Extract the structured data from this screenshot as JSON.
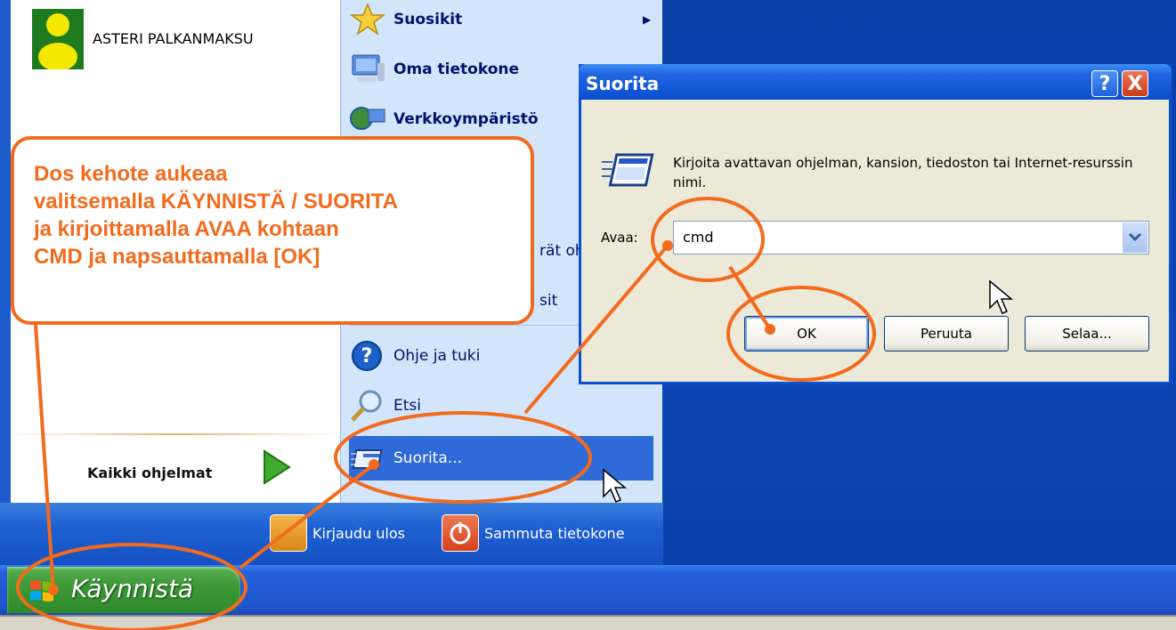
{
  "start_menu": {
    "pinned": [
      {
        "label": "ASTERI PALKANMAKSU"
      }
    ],
    "all_programs": "Kaikki ohjelmat",
    "right_items": [
      {
        "label": "Suosikit",
        "bold": true
      },
      {
        "label": "Oma tietokone",
        "bold": true
      },
      {
        "label": "Verkkoympäristö",
        "bold": true
      },
      {
        "label": "rät oh",
        "bold": false
      },
      {
        "label": "sit",
        "bold": false
      },
      {
        "label": "Ohje ja tuki",
        "bold": false
      },
      {
        "label": "Etsi",
        "bold": false
      },
      {
        "label": "Suorita...",
        "bold": false
      }
    ],
    "logoff": "Kirjaudu ulos",
    "shutdown": "Sammuta tietokone"
  },
  "taskbar": {
    "start_label": "Käynnistä"
  },
  "dialog": {
    "title": "Suorita",
    "help": "?",
    "close": "X",
    "prompt": "Kirjoita avattavan ohjelman, kansion, tiedoston tai Internet-resurssin nimi.",
    "open_label": "Avaa:",
    "input_value": "cmd",
    "ok": "OK",
    "cancel": "Peruuta",
    "browse": "Selaa..."
  },
  "callout": {
    "lines": [
      "Dos kehote aukeaa",
      "valitsemalla KÄYNNISTÄ / SUORITA",
      "ja kirjoittamalla AVAA kohtaan",
      "CMD ja napsauttamalla [OK]"
    ]
  },
  "colors": {
    "accent": "#f26b1d",
    "xp_blue": "#0a4fd0",
    "start_green": "#3c9a38"
  }
}
